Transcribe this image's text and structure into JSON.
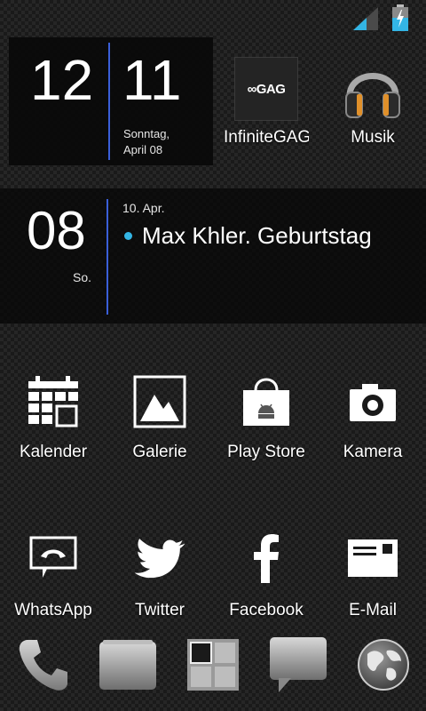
{
  "status_bar": {
    "signal_icon": "signal-icon",
    "battery_icon": "battery-charging-icon"
  },
  "clock": {
    "hour": "12",
    "minute": "11",
    "day": "Sonntag,",
    "date": "April 08"
  },
  "calendar_widget": {
    "day_number": "08",
    "weekday": "So.",
    "event_date": "10. Apr.",
    "event_title": "Max Khler. Geburtstag"
  },
  "top_apps": [
    {
      "label": "InfiniteGAG",
      "icon": "infinitegag-icon",
      "icon_text": "∞GAG"
    },
    {
      "label": "Musik",
      "icon": "headphones-icon"
    }
  ],
  "apps_row1": [
    {
      "label": "Kalender",
      "icon": "calendar-icon"
    },
    {
      "label": "Galerie",
      "icon": "gallery-icon"
    },
    {
      "label": "Play Store",
      "icon": "play-store-icon"
    },
    {
      "label": "Kamera",
      "icon": "camera-icon"
    }
  ],
  "apps_row2": [
    {
      "label": "WhatsApp",
      "icon": "whatsapp-icon"
    },
    {
      "label": "Twitter",
      "icon": "twitter-icon"
    },
    {
      "label": "Facebook",
      "icon": "facebook-icon"
    },
    {
      "label": "E-Mail",
      "icon": "email-icon"
    }
  ],
  "dock": [
    {
      "icon": "phone-icon"
    },
    {
      "icon": "contacts-icon"
    },
    {
      "icon": "app-drawer-icon"
    },
    {
      "icon": "messaging-icon"
    },
    {
      "icon": "browser-globe-icon"
    }
  ],
  "colors": {
    "accent_blue": "#3a5fd9",
    "event_dot": "#33b5e5",
    "battery_fill": "#33b5e5"
  }
}
